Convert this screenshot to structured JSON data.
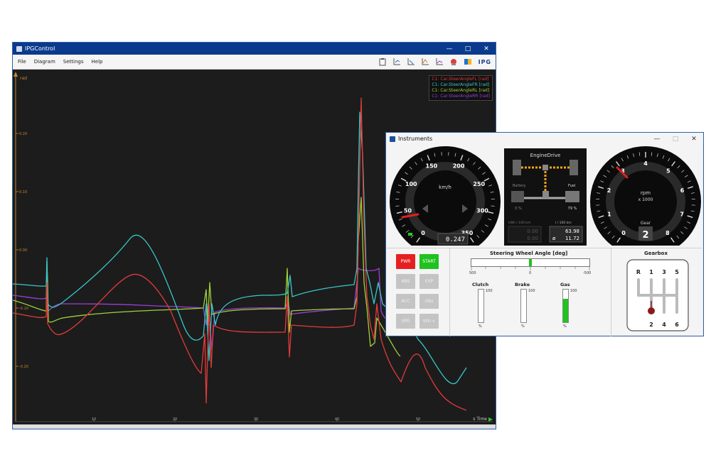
{
  "ipg": {
    "title": "IPGControl",
    "menu": [
      "File",
      "Diagram",
      "Settings",
      "Help"
    ],
    "logo": "IPG",
    "y_unit": "rad",
    "y_ticks": [
      "0.20",
      "0.10",
      "0.00",
      "-0.10",
      "-0.20"
    ],
    "x_ticks": [
      "10",
      "20",
      "30",
      "40",
      "50"
    ],
    "x_label": "s Time",
    "legend": [
      {
        "label": "C1: Car.SteerAngleFL [rad]",
        "color": "#e23b3b"
      },
      {
        "label": "C1: Car.SteerAngleFR [rad]",
        "color": "#38c7c7"
      },
      {
        "label": "C1: Car.SteerAngleRL [rad]",
        "color": "#9fd23a"
      },
      {
        "label": "C1: Car.SteerAngleRR [rad]",
        "color": "#9a3fd6"
      }
    ]
  },
  "instruments": {
    "title": "Instruments",
    "speedometer": {
      "unit": "km/h",
      "labels": [
        "0",
        "50",
        "100",
        "150",
        "200",
        "250",
        "300",
        "350"
      ],
      "odometer": "0.247"
    },
    "enginedrive": {
      "title": "EngineDrive",
      "battery_label": "Battery",
      "battery_value": "0 %",
      "fuel_label": "Fuel",
      "fuel_value": "79 %",
      "consumption_label": "kWh / 100 km",
      "distance_label": "l / 100 km",
      "consumption_value": "0.00",
      "consumption_avg": "0.00",
      "fuel_cons_value": "63.98",
      "fuel_cons_avg": "11.72",
      "avg_symbol": "ø"
    },
    "tachometer": {
      "unit": "rpm",
      "unit_scale": "x 1000",
      "labels": [
        "0",
        "1",
        "2",
        "3",
        "4",
        "5",
        "6",
        "7",
        "8"
      ],
      "gear_label": "Gear",
      "gear_value": "2"
    },
    "buttons": {
      "pwr": "PWR",
      "start": "START",
      "abs": "ABS",
      "esp": "ESP",
      "acc": "ACC",
      "obs": "Obs",
      "spd": "SPD",
      "spd_plus": "SPD +"
    },
    "steering": {
      "title": "Steering Wheel Angle [deg]",
      "min_label": "500",
      "mid_label": "0",
      "max_label": "-500",
      "value_fraction": 0.5
    },
    "pedals": [
      {
        "label": "Clutch",
        "max": "100",
        "unit": "%",
        "level": 0
      },
      {
        "label": "Brake",
        "max": "100",
        "unit": "%",
        "level": 0
      },
      {
        "label": "Gas",
        "max": "100",
        "unit": "%",
        "level": 0.72
      }
    ],
    "gearbox": {
      "title": "Gearbox",
      "top": [
        "R",
        "1",
        "3",
        "5"
      ],
      "bottom": [
        "2",
        "4",
        "6"
      ]
    },
    "colors": {
      "pwr": "#e62020",
      "start": "#1fc21f",
      "needle": "#e02020",
      "gearknob": "#8a1a1a"
    }
  }
}
